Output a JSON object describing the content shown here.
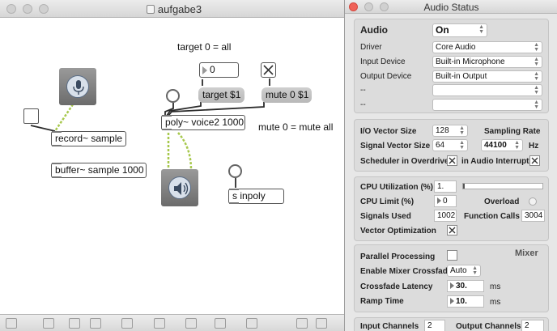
{
  "patcher": {
    "title": "aufgabe3",
    "comments": {
      "target_all": "target 0 = all",
      "mute_all": "mute 0 = mute all"
    },
    "number_value": "0",
    "messages": {
      "target": "target $1",
      "mute": "mute 0 $1"
    },
    "objects": {
      "poly": "poly~ voice2 1000",
      "record": "record~ sample",
      "buffer": "buffer~ sample 1000",
      "send": "s inpoly"
    }
  },
  "audio_status": {
    "title": "Audio Status",
    "audio_label": "Audio",
    "audio_value": "On",
    "driver_label": "Driver",
    "driver_value": "Core Audio",
    "input_device_label": "Input Device",
    "input_device_value": "Built-in Microphone",
    "output_device_label": "Output Device",
    "output_device_value": "Built-in Output",
    "extra1_label": "--",
    "extra2_label": "--",
    "io_vector_label": "I/O Vector Size",
    "io_vector_value": "128",
    "sampling_rate_label": "Sampling Rate",
    "sampling_rate_value": "44100",
    "hz_label": "Hz",
    "signal_vector_label": "Signal Vector Size",
    "signal_vector_value": "64",
    "overdrive_label": "Scheduler in Overdrive",
    "interrupt_label": "in Audio Interrupt",
    "cpu_util_label": "CPU Utilization (%)",
    "cpu_util_value": "1.",
    "cpu_util_percent": 1,
    "cpu_limit_label": "CPU Limit (%)",
    "cpu_limit_value": "0",
    "overload_label": "Overload",
    "signals_used_label": "Signals Used",
    "signals_used_value": "1002",
    "function_calls_label": "Function Calls",
    "function_calls_value": "3004",
    "vector_opt_label": "Vector Optimization",
    "parallel_label": "Parallel Processing",
    "mixer_label": "Mixer",
    "mixer_crossfade_label": "Enable Mixer Crossfade",
    "mixer_crossfade_value": "Auto",
    "crossfade_latency_label": "Crossfade Latency",
    "crossfade_latency_value": "30.",
    "ms_label": "ms",
    "ramp_time_label": "Ramp Time",
    "ramp_time_value": "10.",
    "input_channels_label": "Input Channels",
    "input_channels_value": "2",
    "output_channels_label": "Output Channels",
    "output_channels_value": "2"
  },
  "icons": {
    "mic": "microphone-icon",
    "speaker": "speaker-icon"
  },
  "colors": {
    "signal_cord": "#a7c84d",
    "patch_cord": "#2b2b2b"
  }
}
